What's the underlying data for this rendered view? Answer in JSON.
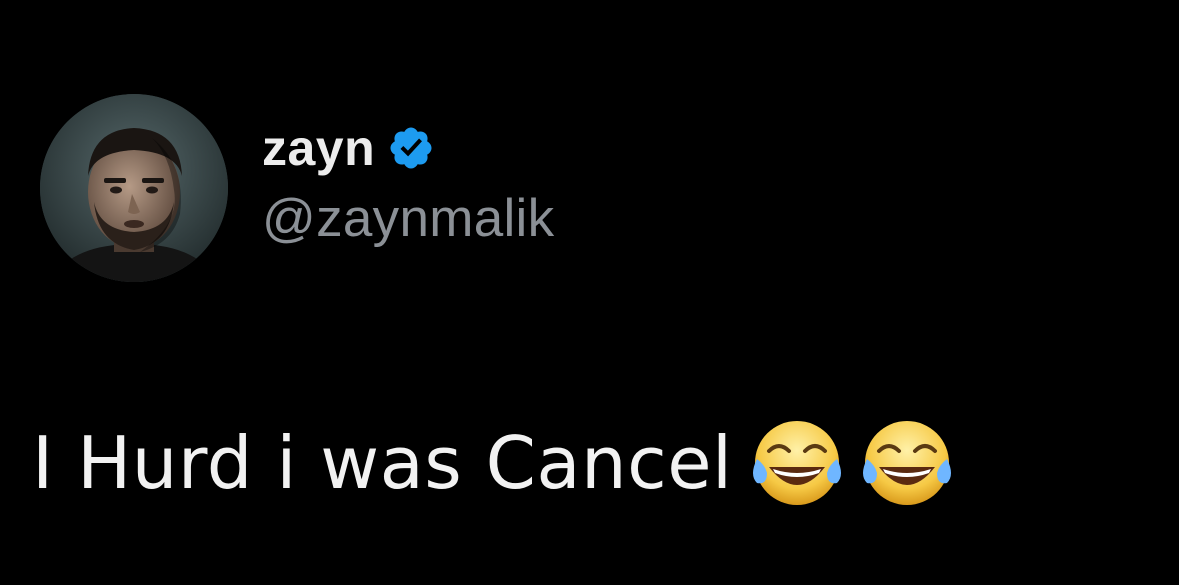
{
  "tweet": {
    "author": {
      "display_name": "zayn",
      "handle": "@zaynmalik",
      "verified": true,
      "avatar_icon": "profile-photo"
    },
    "text": "I Hurd i was Cancel",
    "emojis": [
      "face-with-tears-of-joy-icon",
      "face-with-tears-of-joy-icon"
    ]
  },
  "colors": {
    "background": "#000000",
    "name": "#ececec",
    "handle": "#8b9096",
    "text": "#f2f2f2",
    "verified_badge": "#1d9bf0"
  }
}
